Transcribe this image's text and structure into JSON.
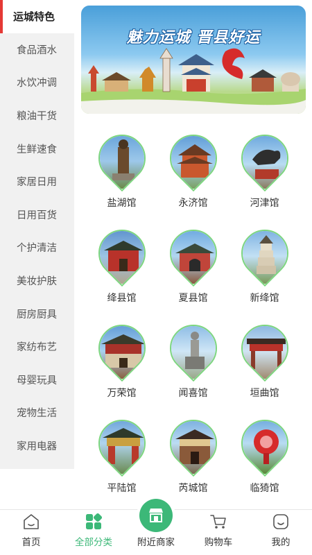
{
  "sidebar": {
    "items": [
      {
        "label": "运城特色",
        "active": true
      },
      {
        "label": "食品酒水",
        "active": false
      },
      {
        "label": "水饮冲调",
        "active": false
      },
      {
        "label": "粮油干货",
        "active": false
      },
      {
        "label": "生鲜速食",
        "active": false
      },
      {
        "label": "家居日用",
        "active": false
      },
      {
        "label": "日用百货",
        "active": false
      },
      {
        "label": "个护清洁",
        "active": false
      },
      {
        "label": "美妆护肤",
        "active": false
      },
      {
        "label": "厨房厨具",
        "active": false
      },
      {
        "label": "家纺布艺",
        "active": false
      },
      {
        "label": "母婴玩具",
        "active": false
      },
      {
        "label": "宠物生活",
        "active": false
      },
      {
        "label": "家用电器",
        "active": false
      }
    ]
  },
  "banner": {
    "title": "魅力运城 晋县好运"
  },
  "halls": [
    {
      "label": "盐湖馆",
      "icon": "statue-icon"
    },
    {
      "label": "永济馆",
      "icon": "tower-icon"
    },
    {
      "label": "河津馆",
      "icon": "horse-statue-icon"
    },
    {
      "label": "绛县馆",
      "icon": "gate-icon"
    },
    {
      "label": "夏县馆",
      "icon": "temple-icon"
    },
    {
      "label": "新绛馆",
      "icon": "pagoda-icon"
    },
    {
      "label": "万荣馆",
      "icon": "hall-icon"
    },
    {
      "label": "闻喜馆",
      "icon": "monument-icon"
    },
    {
      "label": "垣曲馆",
      "icon": "archway-icon"
    },
    {
      "label": "平陆馆",
      "icon": "gateway-icon"
    },
    {
      "label": "芮城馆",
      "icon": "shrine-icon"
    },
    {
      "label": "临猗馆",
      "icon": "sculpture-icon"
    }
  ],
  "bottom_nav": {
    "items": [
      {
        "label": "首页",
        "icon": "home-icon"
      },
      {
        "label": "全部分类",
        "icon": "category-icon",
        "active": true
      },
      {
        "label": "附近商家",
        "icon": "store-icon"
      },
      {
        "label": "购物车",
        "icon": "cart-icon"
      },
      {
        "label": "我的",
        "icon": "profile-icon"
      }
    ]
  },
  "colors": {
    "accent": "#3cb878",
    "active_marker": "#e53935",
    "pin_border": "#7dd67f"
  }
}
